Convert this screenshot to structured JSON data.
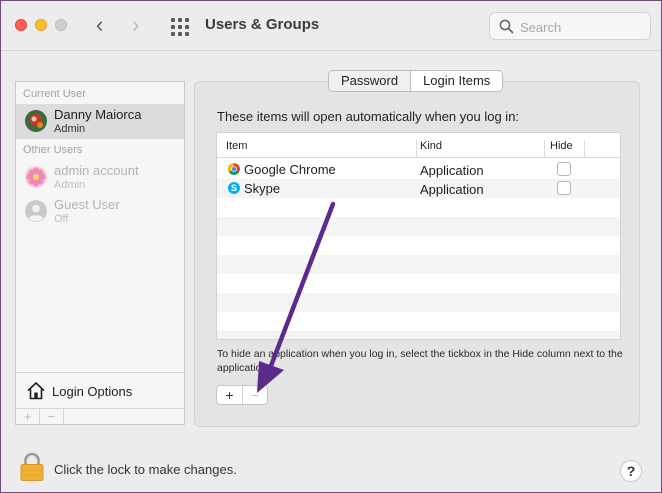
{
  "window": {
    "title": "Users & Groups",
    "search_placeholder": "Search",
    "back_icon": "chevron-left-icon",
    "forward_icon": "chevron-right-icon",
    "grid_icon": "show-all-grid-icon"
  },
  "sidebar": {
    "current_user_header": "Current User",
    "other_users_header": "Other Users",
    "users": [
      {
        "name": "Danny Maiorca",
        "role": "Admin"
      },
      {
        "name": "admin account",
        "role": "Admin"
      },
      {
        "name": "Guest User",
        "role": "Off"
      }
    ],
    "login_options_label": "Login Options",
    "add_label": "+",
    "remove_label": "−"
  },
  "tabs": [
    {
      "label": "Password",
      "active": false
    },
    {
      "label": "Login Items",
      "active": true
    }
  ],
  "login_items": {
    "description": "These items will open automatically when you log in:",
    "columns": [
      "Item",
      "Kind",
      "Hide"
    ],
    "rows": [
      {
        "item": "Google Chrome",
        "kind": "Application",
        "hide": false,
        "icon": "chrome-icon"
      },
      {
        "item": "Skype",
        "kind": "Application",
        "hide": false,
        "icon": "skype-icon"
      }
    ],
    "hint": "To hide an application when you log in, select the tickbox in the Hide column next to the application.",
    "add_label": "+",
    "remove_label": "−"
  },
  "footer": {
    "lock_text": "Click the lock to make changes.",
    "help_label": "?"
  },
  "colors": {
    "annotation_arrow": "#5b2a8c"
  }
}
